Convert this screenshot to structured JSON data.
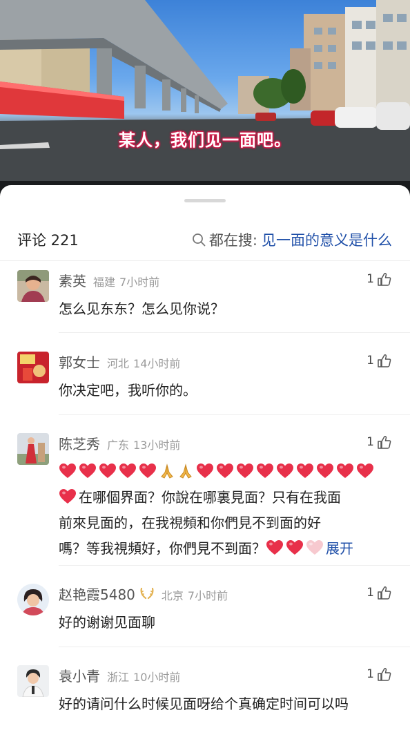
{
  "video": {
    "subtitle": "某人，我们见一面吧。"
  },
  "comments_header": {
    "title": "评论 221",
    "search_label": "都在搜:",
    "search_keyword": "见一面的意义是什么"
  },
  "comments": [
    {
      "name": "素英",
      "region": "福建",
      "time": "7小时前",
      "likes": "1",
      "text": "怎么见东东？怎么见你说？"
    },
    {
      "name": "郭女士",
      "region": "河北",
      "time": "14小时前",
      "likes": "1",
      "text": "你决定吧，我听你的。"
    },
    {
      "name": "陈芝秀",
      "region": "广东",
      "time": "13小时前",
      "likes": "1",
      "text_line2": "在哪個界面？你說在哪裏見面？只有在我面",
      "text_line3": "前來見面的，在我視頻和你們見不到面的好",
      "text_line4": "嗎？等我視頻好，你們見不到面？",
      "expand": "展开"
    },
    {
      "name": "赵艳霞5480",
      "region": "北京",
      "time": "7小时前",
      "likes": "1",
      "text": "好的谢谢见面聊"
    },
    {
      "name": "袁小青",
      "region": "浙江",
      "time": "10小时前",
      "likes": "1",
      "text": "好的请问什么时候见面呀给个真确定时间可以吗"
    }
  ],
  "icons": {
    "like": "thumbs-up-icon",
    "search": "search-icon",
    "heart": "red-heart-emoji",
    "pray": "folded-hands-emoji",
    "badge": "laurel-badge-icon"
  },
  "colors": {
    "link": "#1f4fa8",
    "subtitle_glow": "#d51a4a",
    "meta": "#9a9a9a"
  }
}
